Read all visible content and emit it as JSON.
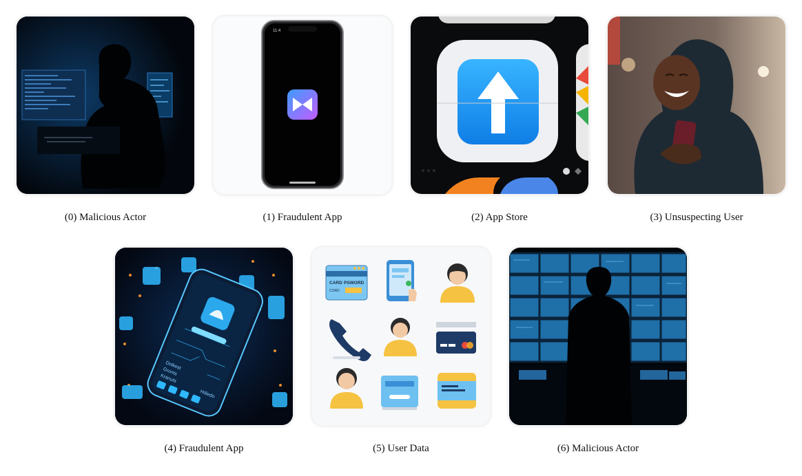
{
  "captions": [
    "(0) Malicious Actor",
    "(1) Fraudulent App",
    "(2) App Store",
    "(3) Unsuspecting User",
    "(4) Fraudulent App",
    "(5) User Data",
    "(6) Malicious Actor"
  ],
  "phone_clock": "11:4",
  "card_text": {
    "card": "CARD",
    "pasword": "PSWORD",
    "cord": "CORD"
  },
  "phone_screen_text": [
    "Dolkest",
    "Gronts",
    "Kranuts"
  ],
  "phone_screen_label": "Hdiedo",
  "colors": {
    "screen_glow": "#2fb8ff",
    "app_store_blue": "#1a8cf0",
    "user_avatar_yellow": "#f5c242"
  }
}
